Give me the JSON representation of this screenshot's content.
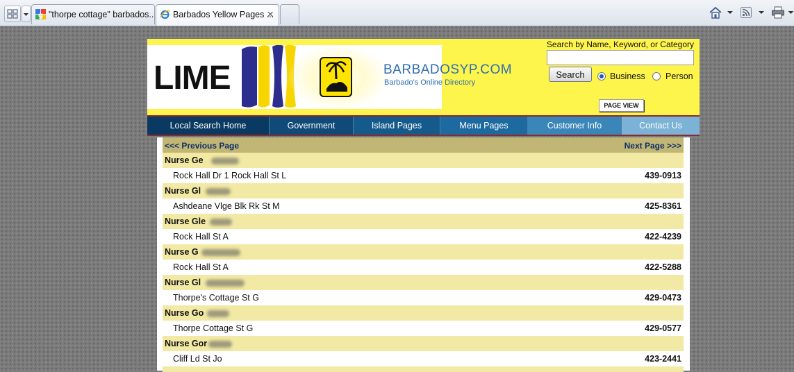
{
  "browser": {
    "tabs": [
      {
        "label": "\"thorpe cottage\" barbados...",
        "active": false
      },
      {
        "label": "Barbados Yellow Pages ...",
        "active": true
      }
    ]
  },
  "header": {
    "logo_text": "LIME",
    "site_name": "BARBADOSYP.COM",
    "site_tagline": "Barbado's Online Directory",
    "search_label": "Search by Name, Keyword, or Category",
    "search_value": "",
    "search_button": "Search",
    "radio_business": "Business",
    "radio_person": "Person",
    "selected_radio": "Business",
    "page_view_button": "PAGE VIEW"
  },
  "nav": [
    {
      "label": "Local Search Home",
      "bg": "#0a3a62"
    },
    {
      "label": "Government",
      "bg": "#0f4a78"
    },
    {
      "label": "Island Pages",
      "bg": "#155a8c"
    },
    {
      "label": "Menu Pages",
      "bg": "#1d6aa0"
    },
    {
      "label": "Customer Info",
      "bg": "#3a86b8"
    },
    {
      "label": "Contact Us",
      "bg": "#7bb2d6"
    }
  ],
  "pager": {
    "prev": "<<< Previous Page",
    "next": "Next Page >>>"
  },
  "listings": [
    {
      "name": "Nurse Ge",
      "address": "Rock Hall Dr 1 Rock Hall St L",
      "phone": "439-0913"
    },
    {
      "name": "Nurse Gl",
      "address": "Ashdeane Vlge Blk Rk St M",
      "phone": "425-8361"
    },
    {
      "name": "Nurse Gle",
      "address": "Rock Hall St A",
      "phone": "422-4239"
    },
    {
      "name": "Nurse G",
      "address": "Rock Hall St A",
      "phone": "422-5288"
    },
    {
      "name": "Nurse Gl",
      "address": "Thorpe's Cottage St G",
      "phone": "429-0473"
    },
    {
      "name": "Nurse Go",
      "address": "Thorpe Cottage St G",
      "phone": "429-0577"
    },
    {
      "name": "Nurse Gor",
      "address": "Cliff Ld St Jo",
      "phone": "423-2441"
    }
  ]
}
